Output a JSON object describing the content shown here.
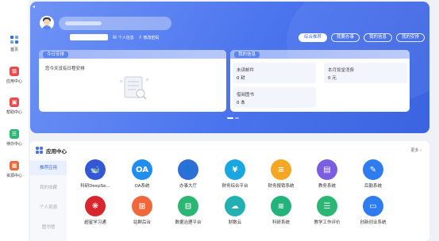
{
  "sidebar": {
    "items": [
      {
        "label": "首页",
        "icon": "home-icon",
        "color": "#2f6ff0"
      },
      {
        "label": "应用中心",
        "icon": "app-center-icon",
        "color": "#e84b4b"
      },
      {
        "label": "帮助中心",
        "icon": "help-center-icon",
        "color": "#e84b4b"
      },
      {
        "label": "待办中心",
        "icon": "todo-center-icon",
        "color": "#2bb673"
      },
      {
        "label": "资源中心",
        "icon": "resource-center-icon",
        "color": "#e86a3a"
      }
    ]
  },
  "hero": {
    "links": {
      "profile": "个人信息",
      "change_password": "修改密码"
    },
    "tabs": [
      "综合推荐",
      "我要办事",
      "我的信息",
      "我的安排"
    ],
    "active_tab": 0,
    "today": {
      "title": "今日安排",
      "empty_text": "您今天没有日程安排"
    },
    "my_info": {
      "title": "我的信息",
      "cells": [
        {
          "label": "未读邮件",
          "value": "0 封"
        },
        {
          "label": "本月饭堂消费",
          "value": "0 元"
        },
        {
          "label": "借阅图书",
          "value": "0 本"
        }
      ]
    }
  },
  "app_center": {
    "title": "应用中心",
    "more": "更多",
    "categories": [
      "推荐应用",
      "我的收藏",
      "个人资源",
      "图书馆"
    ],
    "active_category": 0,
    "apps": [
      {
        "name": "科研DeepSe...",
        "icon": "whale-icon",
        "color": "#3457d5",
        "glyph": "🐋"
      },
      {
        "name": "OA系统",
        "icon": "oa-icon",
        "color": "#1f8ef0",
        "glyph": "OA"
      },
      {
        "name": "办事大厅",
        "icon": "person-icon",
        "color": "#2d6fd6",
        "glyph": "👤"
      },
      {
        "name": "财务综合平台",
        "icon": "finance-icon",
        "color": "#18a7e0",
        "glyph": "¥"
      },
      {
        "name": "财务报销系统",
        "icon": "reimburse-icon",
        "color": "#f5a623",
        "glyph": "≡"
      },
      {
        "name": "教务系统",
        "icon": "teaching-icon",
        "color": "#7b5de0",
        "glyph": "▤"
      },
      {
        "name": "后勤系统",
        "icon": "logistics-icon",
        "color": "#2f7bf0",
        "glyph": "✎"
      },
      {
        "name": "超星学习通",
        "icon": "chaoxing-icon",
        "color": "#d8262f",
        "glyph": "❋"
      },
      {
        "name": "站群后台",
        "icon": "site-admin-icon",
        "color": "#f0673a",
        "glyph": "⊞"
      },
      {
        "name": "数据治理平台",
        "icon": "data-governance-icon",
        "color": "#2bb673",
        "glyph": "⊟"
      },
      {
        "name": "财数云",
        "icon": "cloud-icon",
        "color": "#22b0b0",
        "glyph": "☁"
      },
      {
        "name": "科研系统",
        "icon": "research-icon",
        "color": "#22b37a",
        "glyph": "≋"
      },
      {
        "name": "教学工作评价",
        "icon": "evaluation-icon",
        "color": "#2bb673",
        "glyph": "☰"
      },
      {
        "name": "创新创业系统",
        "icon": "innovation-icon",
        "color": "#2f7bf0",
        "glyph": "▭"
      }
    ]
  }
}
